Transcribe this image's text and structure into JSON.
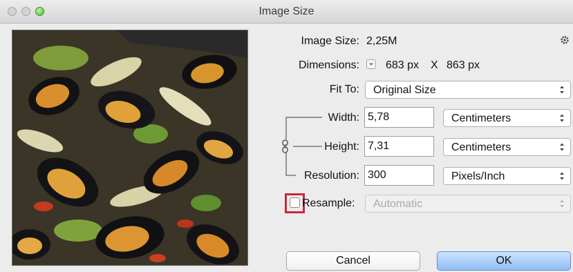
{
  "window": {
    "title": "Image Size",
    "buttons": [
      "close",
      "minimize",
      "zoom"
    ]
  },
  "info": {
    "image_size_label": "Image Size:",
    "image_size_value": "2,25M",
    "dimensions_label": "Dimensions:",
    "dimensions_width": "683 px",
    "dimensions_separator": "X",
    "dimensions_height": "863 px"
  },
  "fit_to": {
    "label": "Fit To:",
    "value": "Original Size"
  },
  "width": {
    "label": "Width:",
    "value": "5,78",
    "unit": "Centimeters"
  },
  "height": {
    "label": "Height:",
    "value": "7,31",
    "unit": "Centimeters"
  },
  "resolution": {
    "label": "Resolution:",
    "value": "300",
    "unit": "Pixels/Inch"
  },
  "resample": {
    "label": "Resample:",
    "checked": false,
    "method": "Automatic"
  },
  "actions": {
    "cancel_label": "Cancel",
    "ok_label": "OK"
  },
  "colors": {
    "highlight": "#c8283a",
    "ok_button": "#8fbdf5"
  },
  "icons": {
    "settings": "gear-icon",
    "constrain": "chain-link-icon",
    "dimensions_toggle": "chevron-down-icon"
  }
}
